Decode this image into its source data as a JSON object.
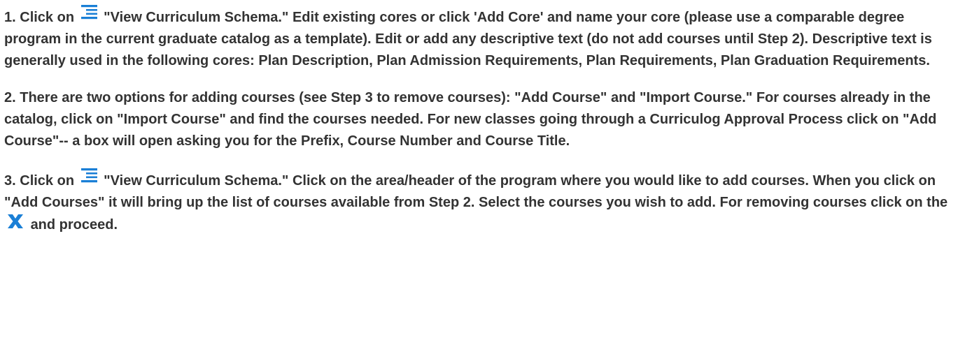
{
  "steps": [
    {
      "number": "1.",
      "pre": "Click on",
      "icon": "list-icon",
      "post": "\"View Curriculum Schema.\" Edit existing cores or click 'Add Core' and name your core (please use a comparable degree program in the current graduate catalog as a template). Edit or add any descriptive text (do not add courses until Step 2). Descriptive text is generally used in the following cores: Plan Description, Plan Admission Requirements, Plan Requirements, Plan Graduation Requirements."
    },
    {
      "number": "2.",
      "text": "There are two options for adding courses (see Step 3 to remove courses): \"Add Course\" and \"Import Course.\" For courses already in the catalog, click on \"Import Course\" and find the courses needed. For new classes going through a Curriculog Approval Process click on \"Add Course\"-- a box will open asking you for the Prefix, Course Number and Course Title."
    },
    {
      "number": "3.",
      "pre": "Click on",
      "icon": "list-icon",
      "mid": "\"View Curriculum Schema.\" Click on the area/header of the program where you would like to add courses. When you click on \"Add Courses\" it will bring up the list of courses available from Step 2. Select the courses you wish to add. For removing courses click on the",
      "icon2": "remove-x-icon",
      "post": "and proceed."
    }
  ],
  "colors": {
    "text": "#333333",
    "icon_blue": "#1a7fd6"
  }
}
